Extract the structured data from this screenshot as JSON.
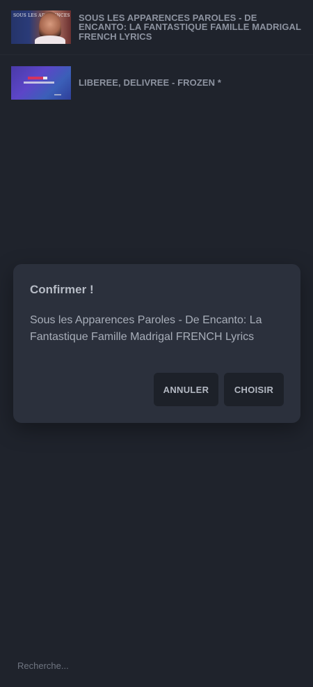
{
  "results": [
    {
      "title": "SOUS LES APPARENCES PAROLES - DE ENCANTO: LA FANTASTIQUE FAMILLE MADRIGAL FRENCH LYRICS",
      "thumbnail_text": "SOUS LES APPARENCES"
    },
    {
      "title": "LIBEREE, DELIVREE - FROZEN *"
    }
  ],
  "dialog": {
    "title": "Confirmer !",
    "message": "Sous les Apparences Paroles - De Encanto: La Fantastique Famille Madrigal FRENCH Lyrics",
    "cancel_label": "ANNULER",
    "confirm_label": "CHOISIR"
  },
  "search": {
    "placeholder": "Recherche..."
  },
  "colors": {
    "background": "#1f232c",
    "dialog_background": "#2b303c",
    "button_background": "#1d2129"
  }
}
